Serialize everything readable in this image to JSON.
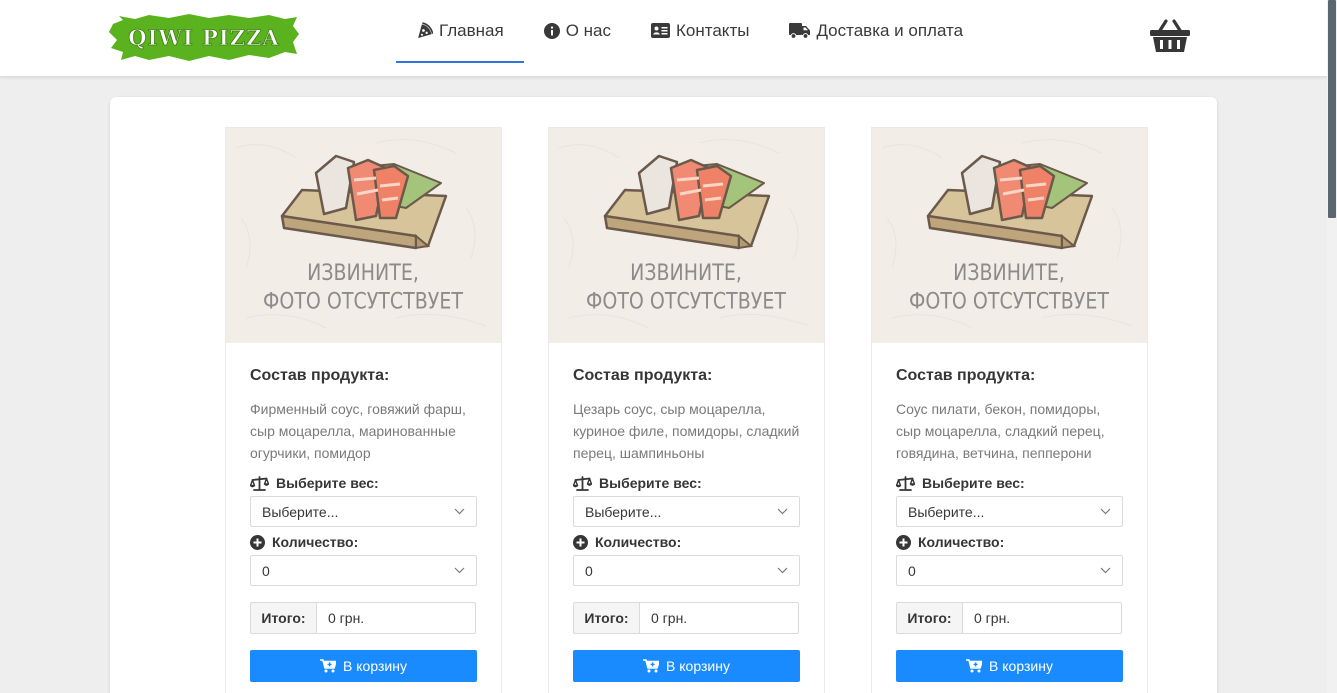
{
  "brand": {
    "logo_text": "QIWI PIZZA",
    "color": "#5ab31e"
  },
  "nav": {
    "items": [
      {
        "label": "Главная",
        "icon": "pizza-slice-icon",
        "active": true
      },
      {
        "label": "О нас",
        "icon": "info-circle-icon",
        "active": false
      },
      {
        "label": "Контакты",
        "icon": "address-card-icon",
        "active": false
      },
      {
        "label": "Доставка и оплата",
        "icon": "truck-icon",
        "active": false
      }
    ]
  },
  "cart_icon": "shopping-basket-icon",
  "photo_placeholder": {
    "line1": "ИЗВИНИТЕ,",
    "line2": "ФОТО ОТСУТСТВУЕТ"
  },
  "labels": {
    "composition": "Состав продукта:",
    "choose_weight": "Выберите вес:",
    "quantity": "Количество:",
    "total": "Итого:",
    "add_to_cart": "В корзину"
  },
  "products": [
    {
      "description": "Фирменный соус, говяжий фарш, сыр моцарелла, маринованные огурчики, помидор",
      "weight_selected": "Выберите...",
      "quantity_selected": "0",
      "total": "0 грн."
    },
    {
      "description": "Цезарь соус, сыр моцарелла, куриное филе, помидоры, сладкий перец, шампиньоны",
      "weight_selected": "Выберите...",
      "quantity_selected": "0",
      "total": "0 грн."
    },
    {
      "description": "Соус пилати, бекон, помидоры, сыр моцарелла, сладкий перец, говядина, ветчина, пепперони",
      "weight_selected": "Выберите...",
      "quantity_selected": "0",
      "total": "0 грн."
    }
  ],
  "colors": {
    "accent": "#3273dc",
    "button": "#1a8bff",
    "page_bg": "#eeeeee"
  }
}
